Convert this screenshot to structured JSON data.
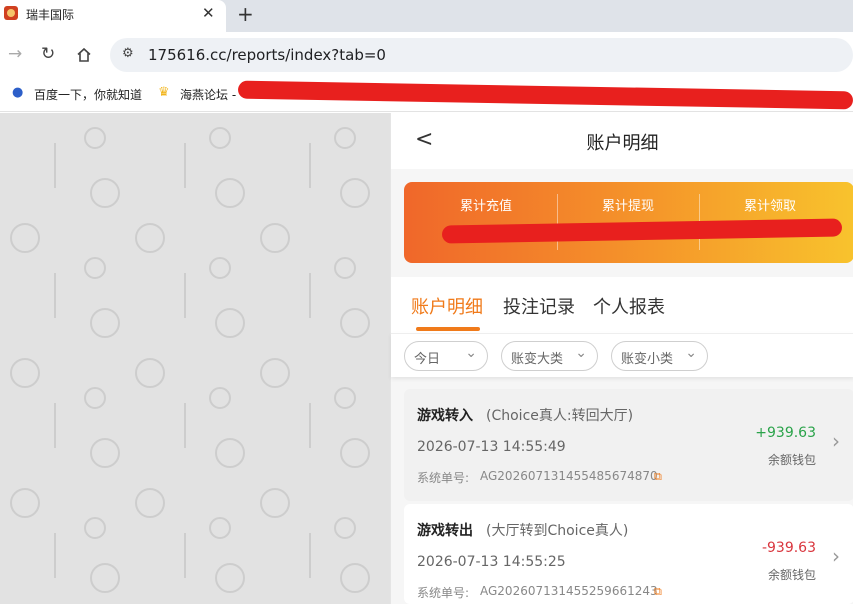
{
  "browser": {
    "tab_title": "瑞丰国际",
    "close_glyph": "✕",
    "new_tab_glyph": "+",
    "url": "175616.cc/reports/index?tab=0",
    "bookmarks": [
      {
        "label": "百度一下，你就知道",
        "icon": "baidu-paw-icon"
      },
      {
        "label": "海燕论坛 -",
        "icon": "trophy-icon"
      }
    ]
  },
  "page": {
    "title": "账户明细",
    "stats": {
      "labels": [
        "累计充值",
        "累计提现",
        "累计领取"
      ]
    },
    "tabs": [
      "账户明细",
      "投注记录",
      "个人报表"
    ],
    "active_tab": 0,
    "filters": [
      "今日",
      "账变大类",
      "账变小类"
    ],
    "records": [
      {
        "type": "游戏转入",
        "desc": "(Choice真人:转回大厅)",
        "time": "2026-07-13 14:55:49",
        "order_label": "系统单号:",
        "order_no": "AG20260713145548567487​0",
        "amount": "+939.63",
        "wallet": "余额钱包"
      },
      {
        "type": "游戏转出",
        "desc": "(大厅转到Choice真人)",
        "time": "2026-07-13 14:55:25",
        "order_label": "系统单号:",
        "order_no": "AG20260713145525966124​3",
        "amount": "-939.63",
        "wallet": "余额钱包"
      }
    ]
  },
  "colors": {
    "accent": "#f07a1a",
    "positive": "#2aa34a",
    "negative": "#d9363e",
    "redaction": "#e8201e"
  }
}
